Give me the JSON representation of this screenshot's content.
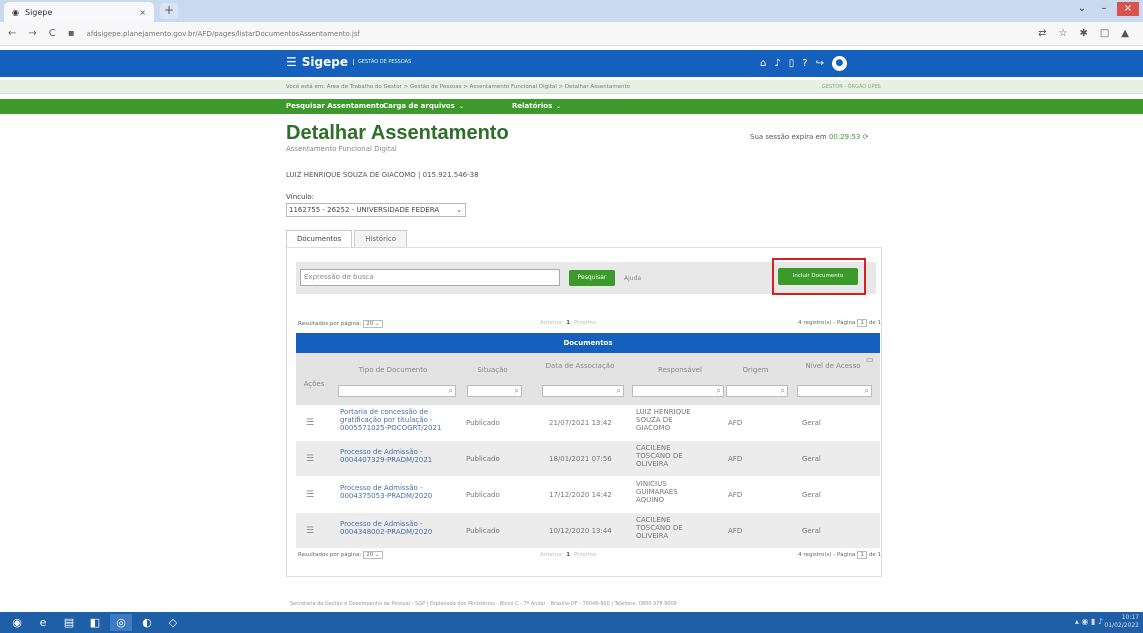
{
  "browser": {
    "tab_title": "Sigepe",
    "tab_close": "×",
    "new_tab": "+",
    "url": "afdsigepe.planejamento.gov.br/AFD/pages/listarDocumentosAssentamento.jsf",
    "nav_back": "←",
    "nav_forward": "→",
    "nav_reload": "C"
  },
  "header": {
    "logo": "Sigepe",
    "logo_sub": "GESTÃO DE PESSOAS",
    "icons": [
      "home-icon",
      "bell-icon",
      "mobile-icon",
      "help-icon",
      "logout-icon",
      "user-avatar-icon"
    ]
  },
  "breadcrumb": {
    "text": "Você está em: Área de Trabalho do Gestor > Gestão de Pessoas > Assentamento Funcional Digital > Detalhar Assentamento",
    "role": "GESTOR - ÓRGÃO UPES"
  },
  "menu": {
    "items": [
      "Pesquisar Assentamento",
      "Carga de arquivos",
      "Relatórios"
    ]
  },
  "page": {
    "title": "Detalhar Assentamento",
    "subtitle": "Assentamento Funcional Digital",
    "session_label": "Sua sessão expira em",
    "session_time": "00:29:53",
    "person": "LUIZ HENRIQUE SOUZA DE GIACOMO | 015.921.546-38",
    "vinculo_label": "Vínculo:",
    "vinculo_value": "1162755 - 26252 - UNIVERSIDADE FEDERA"
  },
  "tabs": [
    "Documentos",
    "Histórico"
  ],
  "search": {
    "placeholder": "Expressão de busca",
    "search_button": "Pesquisar",
    "help_link": "Ajuda",
    "include_button": "Incluir Documento"
  },
  "pagination": {
    "results_label": "Resultados por página:",
    "per_page": "20",
    "prev": "Anterior",
    "page": "1",
    "next": "Próximo",
    "records": "4 registro(s) - Página",
    "page_of": "de 1"
  },
  "table": {
    "title": "Documentos",
    "columns": [
      "Ações",
      "Tipo de Documento",
      "Situação",
      "Data de Associação",
      "Responsável",
      "Origem",
      "Nível de Acesso"
    ],
    "rows": [
      {
        "tipo": "Portaria de concessão de gratificação por titulação - 0005571025-POCOGRT/2021",
        "situacao": "Publicado",
        "data": "21/07/2021 13:42",
        "responsavel": "LUIZ HENRIQUE SOUZA DE GIACOMO",
        "origem": "AFD",
        "nivel": "Geral"
      },
      {
        "tipo": "Processo de Admissão - 0004407329-PRADM/2021",
        "situacao": "Publicado",
        "data": "18/01/2021 07:56",
        "responsavel": "CACILENE TOSCANO DE OLIVEIRA",
        "origem": "AFD",
        "nivel": "Geral"
      },
      {
        "tipo": "Processo de Admissão - 0004375053-PRADM/2020",
        "situacao": "Publicado",
        "data": "17/12/2020 14:42",
        "responsavel": "VINICIUS GUIMARAES AQUINO",
        "origem": "AFD",
        "nivel": "Geral"
      },
      {
        "tipo": "Processo de Admissão - 0004348002-PRADM/2020",
        "situacao": "Publicado",
        "data": "10/12/2020 13:44",
        "responsavel": "CACILENE TOSCANO DE OLIVEIRA",
        "origem": "AFD",
        "nivel": "Geral"
      }
    ]
  },
  "footer": "Secretaria de Gestão e Desempenho de Pessoal - SGP | Esplanada dos Ministérios - Bloco C - 7º Andar - Brasília-DF - 70046-900 | Telefone: 0800 978 9009",
  "taskbar": {
    "time": "10:17",
    "date": "01/02/2022"
  },
  "colors": {
    "brand_blue": "#1560bd",
    "brand_green": "#3b9a2a",
    "title_green": "#2e6e2a",
    "highlight_red": "#d32020"
  }
}
